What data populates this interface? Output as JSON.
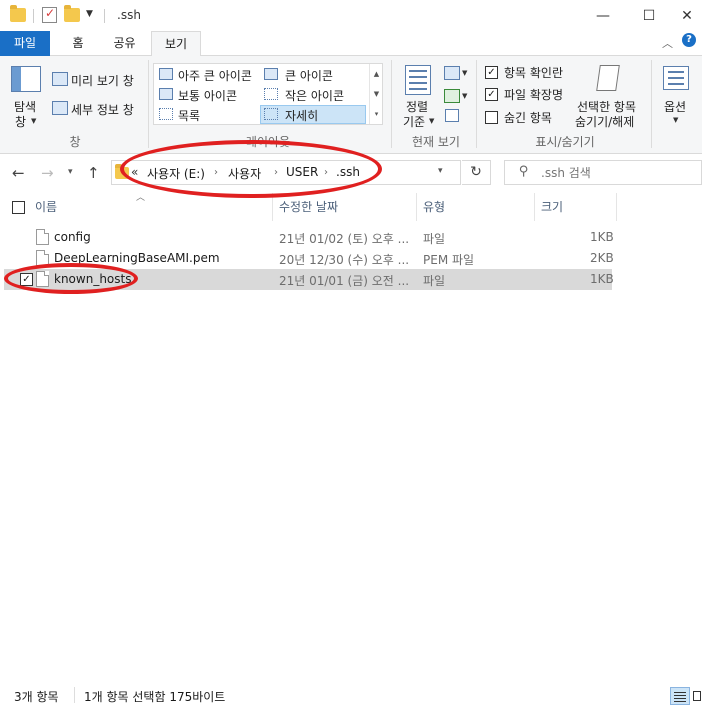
{
  "window": {
    "title": ".ssh",
    "minimize": "—",
    "maximize": "☐",
    "close": "✕",
    "help_chevron": "︿",
    "help": "?"
  },
  "ribbon_tabs": [
    "파일",
    "홈",
    "공유",
    "보기"
  ],
  "ribbon": {
    "pane": {
      "nav_pane_label": "탐색",
      "nav_pane_label2": "창",
      "preview_pane": "미리 보기 창",
      "details_pane": "세부 정보 창",
      "group_label": "창"
    },
    "layout": {
      "extra_large": "아주 큰 아이콘",
      "large": "큰 아이콘",
      "medium": "보통 아이콘",
      "small": "작은 아이콘",
      "list": "목록",
      "details": "자세히",
      "group_label": "레이아웃",
      "selected": "자세히"
    },
    "current_view": {
      "sort_by": "정렬",
      "sort_by2": "기준",
      "group_label": "현재 보기"
    },
    "show_hide": {
      "item_checkboxes": "항목 확인란",
      "item_checkboxes_checked": true,
      "file_extensions": "파일 확장명",
      "file_extensions_checked": true,
      "hidden_items": "숨긴 항목",
      "hidden_items_checked": false,
      "hide_selected": "선택한 항목",
      "hide_selected2": "숨기기/해제",
      "group_label": "표시/숨기기"
    },
    "options": {
      "label": "옵션"
    }
  },
  "address_bar": {
    "overflow": "«",
    "path": [
      "사용자 (E:)",
      "사용자",
      "USER",
      ".ssh"
    ]
  },
  "search": {
    "placeholder": ".ssh 검색"
  },
  "columns": {
    "name": "이름",
    "modified": "수정한 날짜",
    "type": "유형",
    "size": "크기"
  },
  "files": [
    {
      "name": "config",
      "modified": "21년 01/02 (토) 오후 ...",
      "type": "파일",
      "size": "1KB",
      "selected": false
    },
    {
      "name": "DeepLearningBaseAMI.pem",
      "modified": "20년 12/30 (수) 오후 ...",
      "type": "PEM 파일",
      "size": "2KB",
      "selected": false
    },
    {
      "name": "known_hosts",
      "modified": "21년 01/01 (금) 오전 ...",
      "type": "파일",
      "size": "1KB",
      "selected": true
    }
  ],
  "status": {
    "item_count": "3개 항목",
    "selection": "1개 항목 선택함 175바이트"
  },
  "colors": {
    "file_tab": "#1a6fc6",
    "selected_row": "#d9d9d9",
    "annotation": "#e02020"
  }
}
